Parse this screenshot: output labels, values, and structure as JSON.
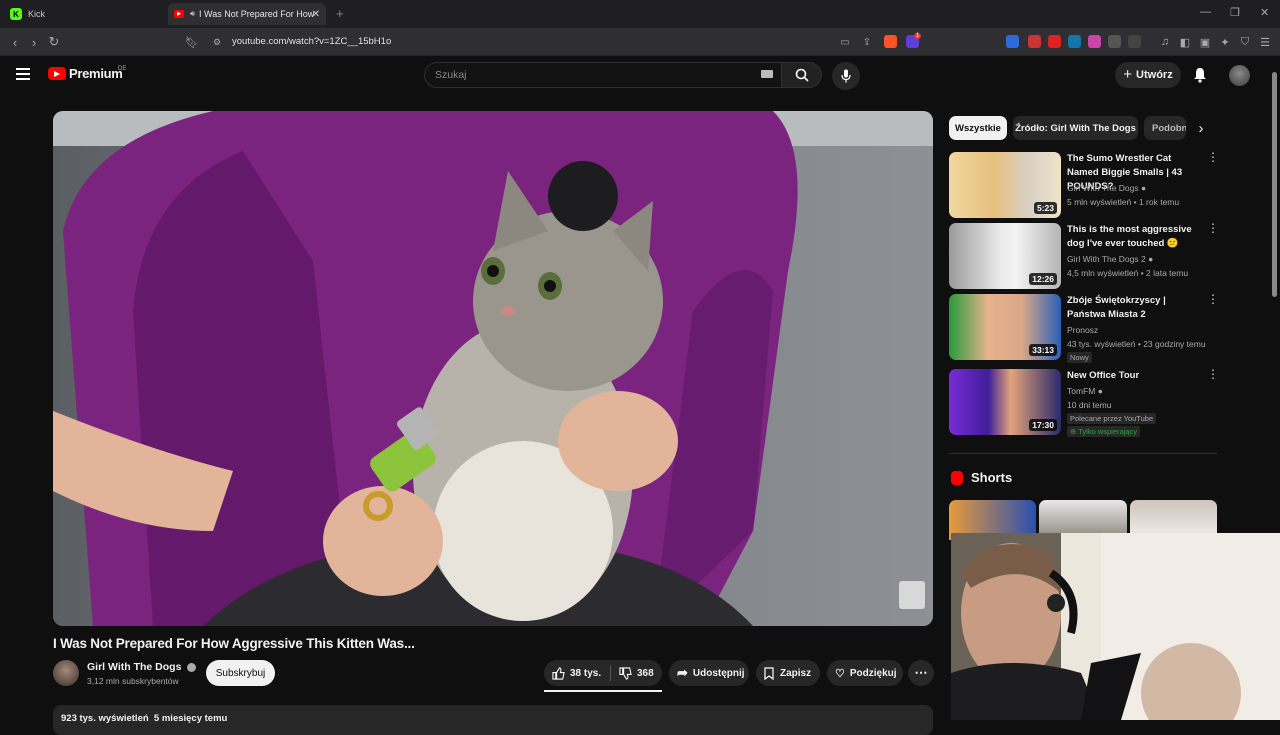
{
  "browser": {
    "tabs": [
      {
        "label": "Kick",
        "active": false
      },
      {
        "label": "I Was Not Prepared For How",
        "active": true
      }
    ],
    "address": "youtube.com/watch?v=1ZC__15bH1o",
    "brave_badge": "1"
  },
  "header": {
    "logo_text": "Premium",
    "region": "DE",
    "search_placeholder": "Szukaj",
    "create_label": "Utwórz"
  },
  "video": {
    "title": "I Was Not Prepared For How Aggressive This Kitten Was...",
    "channel": "Girl With The Dogs",
    "subscribers": "3,12 mln subskrybentów",
    "subscribe_label": "Subskrybuj",
    "likes": "38 tys.",
    "dislikes": "368",
    "share_label": "Udostępnij",
    "save_label": "Zapisz",
    "thanks_label": "Podziękuj",
    "description_partial": "923 tys. wyświetleń  5 miesięcy temu"
  },
  "sidebar": {
    "chips": [
      "Wszystkie",
      "Źródło: Girl With The Dogs",
      "Podobn"
    ],
    "recommendations": [
      {
        "title": "The Sumo Wrestler Cat Named Biggie Smalls | 43 POUNDS?",
        "channel": "Girl With The Dogs",
        "meta": "5 mln wyświetleń • 1 rok temu",
        "duration": "5:23"
      },
      {
        "title": "This is the most aggressive dog I've ever touched 😕",
        "channel": "Girl With The Dogs 2",
        "meta": "4,5 mln wyświetleń • 2 lata temu",
        "duration": "12:26"
      },
      {
        "title": "Zbóje Świętokrzyscy | Państwa Miasta 2",
        "channel": "Pronosz",
        "meta": "43 tys. wyświetleń • 23 godziny temu",
        "duration": "33:13",
        "badge": "Nowy"
      },
      {
        "title": "New Office Tour",
        "channel": "TomFM",
        "meta": "10 dni temu",
        "duration": "17:30",
        "badge": "Polecane przez YouTube",
        "members": "Tylko wspierający"
      }
    ],
    "shorts_heading": "Shorts"
  }
}
